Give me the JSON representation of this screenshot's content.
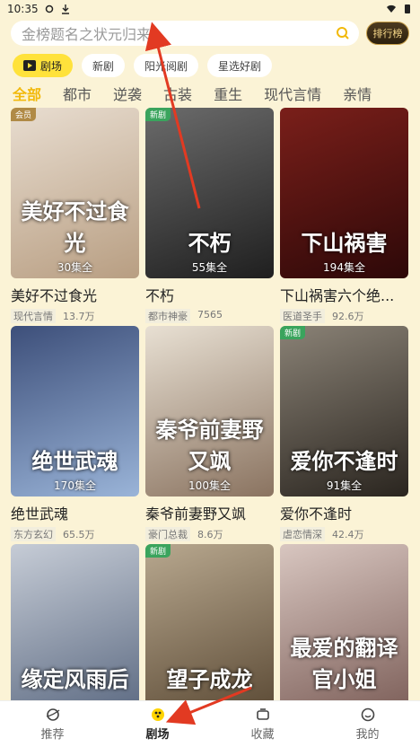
{
  "status": {
    "time": "10:35"
  },
  "search": {
    "placeholder": "金榜题名之状元归来",
    "rank_label": "排行榜"
  },
  "pills": [
    "剧场",
    "新剧",
    "阳光阅剧",
    "星选好剧"
  ],
  "categories": [
    "全部",
    "都市",
    "逆袭",
    "古装",
    "重生",
    "现代言情",
    "亲情"
  ],
  "cards": [
    {
      "badge": "会员",
      "badge_type": "vip",
      "episodes": "30集全",
      "poster_title": "美好不过食光",
      "title": "美好不过食光",
      "tag": "现代言情",
      "views": "13.7万",
      "colors": [
        "#e8ddd0",
        "#b89e82"
      ]
    },
    {
      "badge": "新剧",
      "badge_type": "new",
      "episodes": "55集全",
      "poster_title": "不朽",
      "title": "不朽",
      "tag": "都市神豪",
      "views": "7565",
      "colors": [
        "#6b6b6b",
        "#1f1f1f"
      ]
    },
    {
      "badge": "",
      "badge_type": "",
      "episodes": "194集全",
      "poster_title": "下山祸害",
      "title": "下山祸害六个绝...",
      "tag": "医道圣手",
      "views": "92.6万",
      "colors": [
        "#7a1f1a",
        "#2d0808"
      ]
    },
    {
      "badge": "",
      "badge_type": "",
      "episodes": "170集全",
      "poster_title": "绝世武魂",
      "title": "绝世武魂",
      "tag": "东方玄幻",
      "views": "65.5万",
      "colors": [
        "#3d4f7a",
        "#9ab4d8"
      ]
    },
    {
      "badge": "",
      "badge_type": "",
      "episodes": "100集全",
      "poster_title": "秦爷前妻野又飒",
      "title": "秦爷前妻野又飒",
      "tag": "豪门总裁",
      "views": "8.6万",
      "colors": [
        "#e8e0d3",
        "#8a7360"
      ]
    },
    {
      "badge": "新剧",
      "badge_type": "new",
      "episodes": "91集全",
      "poster_title": "爱你不逢时",
      "title": "爱你不逢时",
      "tag": "虐恋情深",
      "views": "42.4万",
      "colors": [
        "#8a8276",
        "#2a251f"
      ]
    },
    {
      "badge": "",
      "badge_type": "",
      "episodes": "",
      "poster_title": "缘定风雨后",
      "title": "",
      "tag": "",
      "views": "",
      "colors": [
        "#c6ccd6",
        "#5c6a82"
      ]
    },
    {
      "badge": "新剧",
      "badge_type": "new",
      "episodes": "",
      "poster_title": "望子成龙",
      "title": "",
      "tag": "",
      "views": "",
      "colors": [
        "#b8a88f",
        "#5b4a35"
      ]
    },
    {
      "badge": "",
      "badge_type": "",
      "episodes": "",
      "poster_title": "最爱的翻译官小姐",
      "title": "",
      "tag": "",
      "views": "",
      "colors": [
        "#d8c6c0",
        "#7c5e58"
      ]
    }
  ],
  "tabs": [
    "推荐",
    "剧场",
    "收藏",
    "我的"
  ]
}
